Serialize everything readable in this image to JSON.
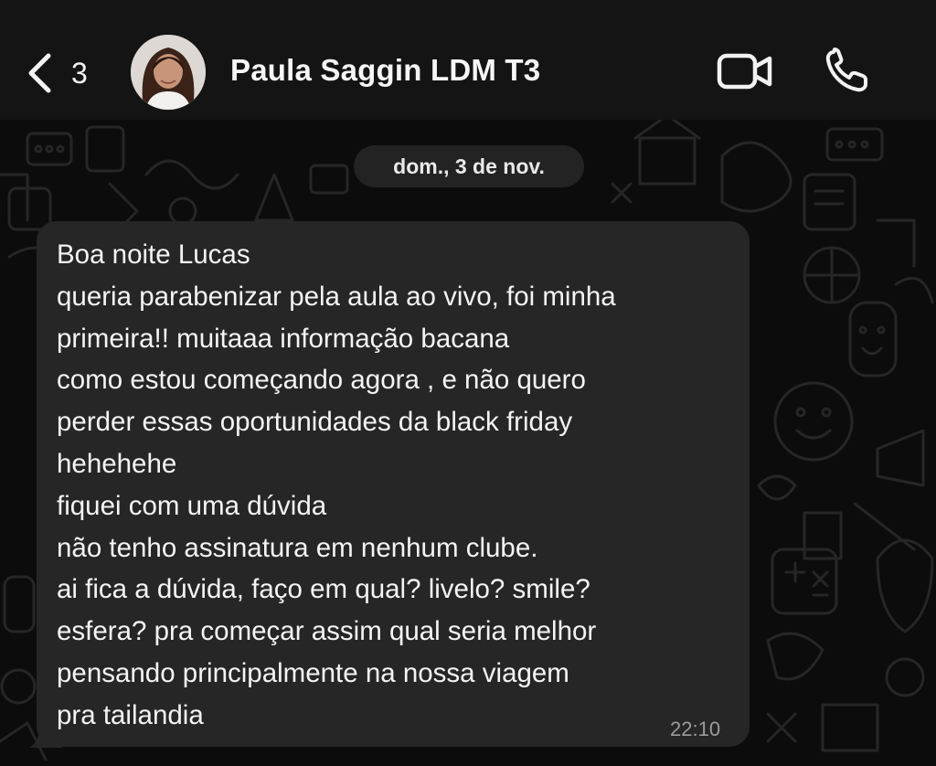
{
  "header": {
    "back_count": "3",
    "contact_name": "Paula Saggin LDM T3",
    "icons": [
      "chevron-left-icon",
      "avatar",
      "video-call-icon",
      "phone-icon"
    ]
  },
  "chat": {
    "date_label": "dom., 3 de nov.",
    "message": {
      "lines": [
        "Boa noite Lucas",
        "queria parabenizar pela aula ao vivo, foi minha",
        "primeira!! muitaaa informação bacana",
        "como estou começando agora , e não quero",
        "perder essas oportunidades da black friday",
        "hehehehe",
        "fiquei com uma dúvida",
        "não tenho assinatura em nenhum clube.",
        "ai fica a dúvida, faço em qual? livelo? smile?",
        "esfera?  pra começar assim qual seria melhor",
        "pensando principalmente na nossa viagem",
        "pra tailandia"
      ],
      "time": "22:10"
    }
  },
  "colors": {
    "header_bg": "#141414",
    "chat_bg": "#0c0c0c",
    "bubble_bg": "#262627",
    "date_pill_bg": "#232323",
    "text": "#f4f4f4",
    "timestamp": "#9c9c9c"
  }
}
